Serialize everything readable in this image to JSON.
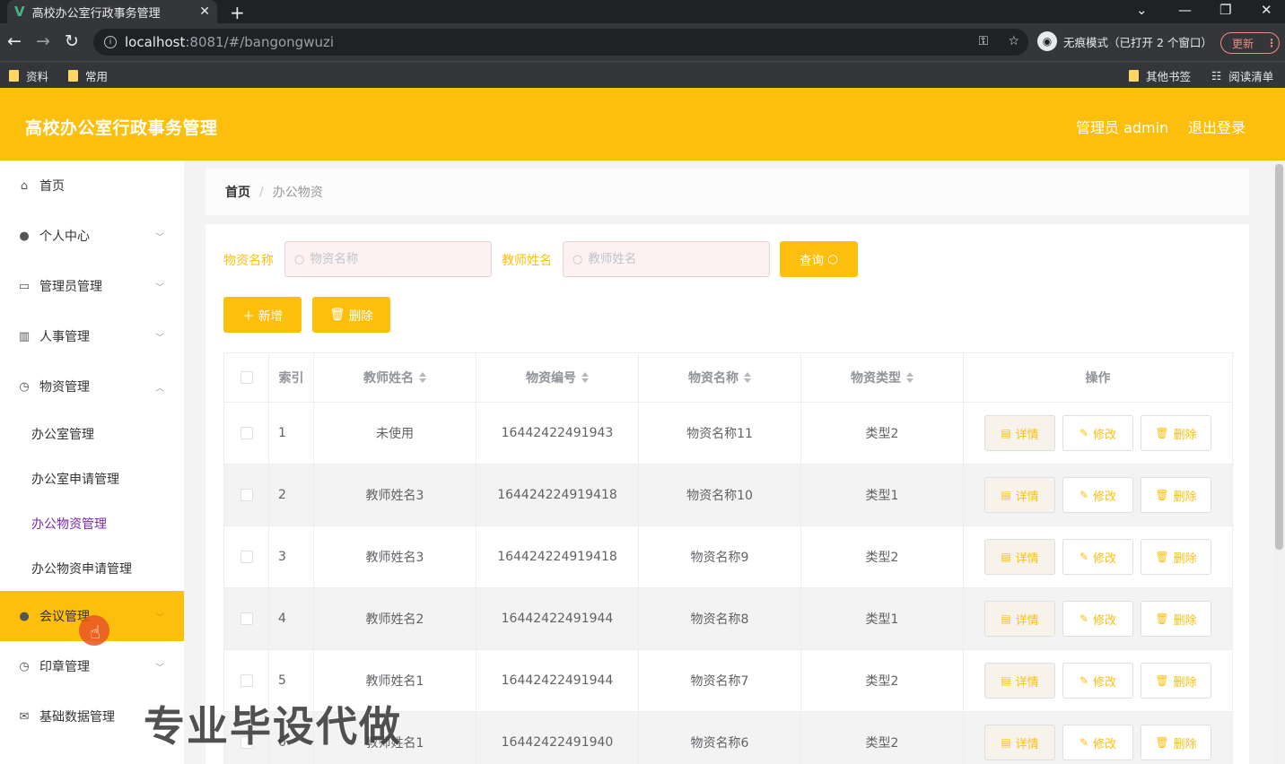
{
  "browser": {
    "tab_title": "高校办公室行政事务管理",
    "url_host": "localhost",
    "url_path": ":8081/#/bangongwuzi",
    "incognito_label": "无痕模式（已打开 2 个窗口）",
    "update_label": "更新",
    "bookmarks": [
      "资料",
      "常用"
    ],
    "bookmarks_right": [
      "其他书签",
      "阅读清单"
    ]
  },
  "header": {
    "title": "高校办公室行政事务管理",
    "admin_label": "管理员 admin",
    "logout_label": "退出登录"
  },
  "sidebar": {
    "items": [
      {
        "label": "首页",
        "icon": "home-icon"
      },
      {
        "label": "个人中心",
        "icon": "user-icon"
      },
      {
        "label": "管理员管理",
        "icon": "id-card-icon"
      },
      {
        "label": "人事管理",
        "icon": "books-icon"
      },
      {
        "label": "物资管理",
        "icon": "compass-icon"
      }
    ],
    "sub_items": [
      "办公室管理",
      "办公室申请管理",
      "办公物资管理",
      "办公物资申请管理"
    ],
    "items_after": [
      {
        "label": "会议管理",
        "icon": "bulb-icon"
      },
      {
        "label": "印章管理",
        "icon": "compass-icon"
      },
      {
        "label": "基础数据管理",
        "icon": "mail-icon"
      }
    ]
  },
  "breadcrumb": {
    "home": "首页",
    "current": "办公物资"
  },
  "search": {
    "name_label": "物资名称",
    "name_placeholder": "物资名称",
    "teacher_label": "教师姓名",
    "teacher_placeholder": "教师姓名",
    "query_label": "查询"
  },
  "actions": {
    "add_label": "新增",
    "delete_label": "删除"
  },
  "table": {
    "columns": [
      "索引",
      "教师姓名",
      "物资编号",
      "物资名称",
      "物资类型",
      "操作"
    ],
    "rows": [
      {
        "index": "1",
        "teacher": "未使用",
        "code": "16442422491943",
        "name": "物资名称11",
        "type": "类型2"
      },
      {
        "index": "2",
        "teacher": "教师姓名3",
        "code": "164424224919418",
        "name": "物资名称10",
        "type": "类型1"
      },
      {
        "index": "3",
        "teacher": "教师姓名3",
        "code": "164424224919418",
        "name": "物资名称9",
        "type": "类型2"
      },
      {
        "index": "4",
        "teacher": "教师姓名2",
        "code": "16442422491944",
        "name": "物资名称8",
        "type": "类型1"
      },
      {
        "index": "5",
        "teacher": "教师姓名1",
        "code": "16442422491944",
        "name": "物资名称7",
        "type": "类型2"
      },
      {
        "index": "6",
        "teacher": "教师姓名1",
        "code": "16442422491940",
        "name": "物资名称6",
        "type": "类型2"
      }
    ],
    "op_labels": {
      "detail": "详情",
      "edit": "修改",
      "delete": "删除"
    }
  },
  "watermark": "专业毕设代做",
  "colors": {
    "accent": "#fdbf0d",
    "active_submenu": "#7b2aa8"
  }
}
